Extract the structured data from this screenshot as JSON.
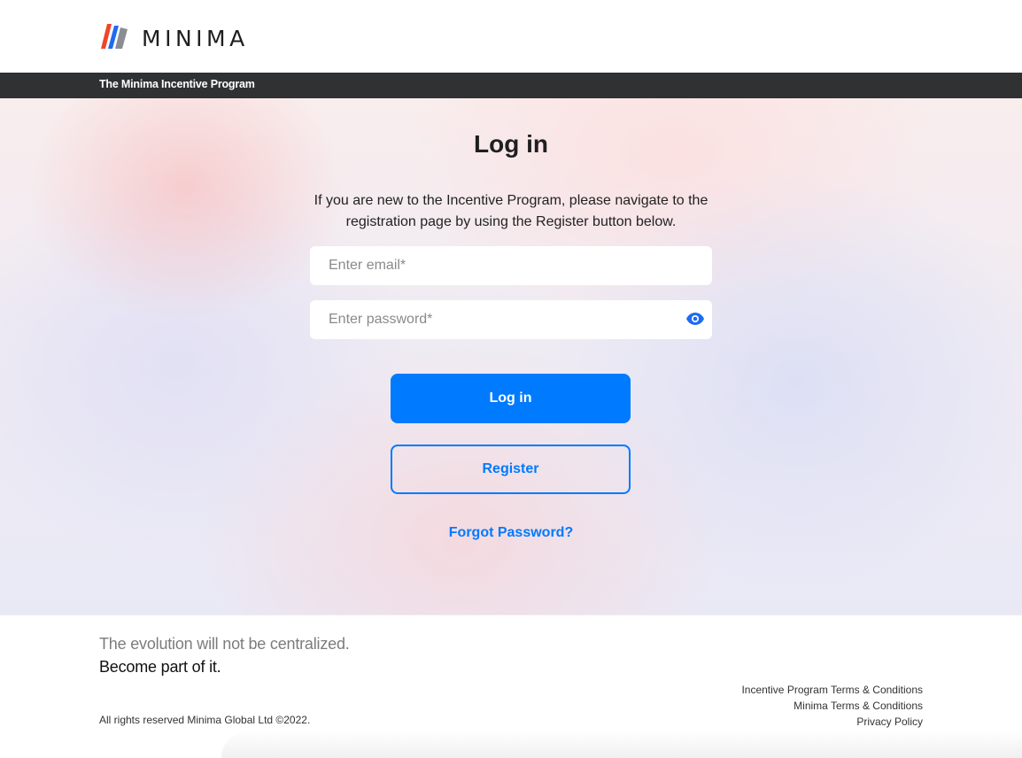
{
  "header": {
    "logo_text": "MINIMA",
    "program_title": "The Minima Incentive Program"
  },
  "login": {
    "title": "Log in",
    "intro": "If you are new to the Incentive Program, please navigate to the registration page by using the Register button below.",
    "email_placeholder": "Enter email*",
    "password_placeholder": "Enter password*",
    "login_button": "Log in",
    "register_button": "Register",
    "forgot_link": "Forgot Password?"
  },
  "footer": {
    "tagline_1": "The evolution will not be centralized.",
    "tagline_2": "Become part of it.",
    "copyright": "All rights reserved Minima Global Ltd ©2022.",
    "links": [
      "Incentive Program Terms & Conditions",
      "Minima Terms & Conditions",
      "Privacy Policy"
    ]
  },
  "colors": {
    "accent": "#007aff",
    "subbar": "#2f3133",
    "logo_red": "#f0452a",
    "logo_blue": "#1e6bf2",
    "logo_gray": "#8a8d94"
  },
  "icons": {
    "logo": "minima-logo-icon",
    "password_toggle": "eye-icon"
  }
}
